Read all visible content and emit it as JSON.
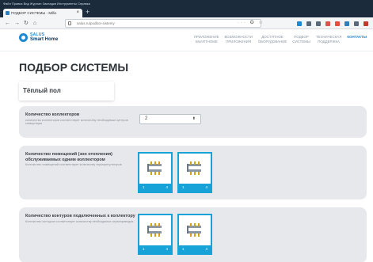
{
  "browser": {
    "menu": "Файл  Правка  Вид  Журнал  Закладки  Инструменты  Справка",
    "tab_title": "ПОДБОР СИСТЕМЫ - Millis",
    "url": "salus.ru/podbor-sistemy",
    "url_actions": "··· ✪ ☆"
  },
  "site": {
    "logo_top": "SALUS",
    "logo_bottom": "Smart Home",
    "nav": [
      {
        "line1": "ПРИЛОЖЕНИЕ",
        "line2": "SMARTHOME"
      },
      {
        "line1": "ВОЗМОЖНОСТИ",
        "line2": "ПРИЛОЖЕНИЯ"
      },
      {
        "line1": "ДОСТУПНОЕ",
        "line2": "ОБОРУДОВАНИЕ"
      },
      {
        "line1": "ПОДБОР",
        "line2": "СИСТЕМЫ"
      },
      {
        "line1": "ТЕХНИЧЕСКАЯ",
        "line2": "ПОДДЕРЖКА"
      },
      {
        "line1": "",
        "line2": "КОНТАКТЫ"
      }
    ]
  },
  "page": {
    "title": "ПОДБОР СИСТЕМЫ",
    "section": "Тёплый пол",
    "rows": [
      {
        "title": "Количество коллекторов",
        "hint": "количество коллекторов соответствует количеству необходимых центров коммутации",
        "select_value": "2"
      },
      {
        "title": "Количество помещений (зон отопления) обслуживаемых одним коллектором",
        "hint": "Количество помещений соответствует количеству терморегуляторов",
        "cards": [
          {
            "left": "1",
            "right": "4"
          },
          {
            "left": "1",
            "right": "4"
          }
        ]
      },
      {
        "title": "Количество контуров подключенных к коллектору",
        "hint": "Количество контуров соответствует количеству необходимых сервоприводов",
        "cards": [
          {
            "left": "1",
            "right": "4"
          },
          {
            "left": "1",
            "right": "4"
          }
        ]
      }
    ]
  },
  "colors": {
    "accent": "#17a2d8",
    "brand": "#1e88d1",
    "row_bg": "#e6e8eb"
  }
}
